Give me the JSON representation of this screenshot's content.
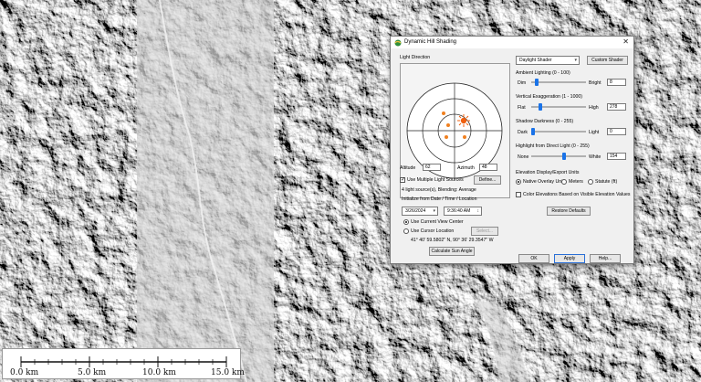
{
  "map": {
    "scalebar": {
      "labels": [
        "0.0 km",
        "5.0 km",
        "10.0 km",
        "15.0 km"
      ]
    }
  },
  "dialog": {
    "title": "Dynamic Hill Shading",
    "light_direction": {
      "group_label": "Light Direction",
      "altitude_label": "Altitude",
      "altitude_value": "62",
      "azimuth_label": "Azimuth",
      "azimuth_value": "48"
    },
    "multiple_light": {
      "label": "Use Multiple Light Sources",
      "checked": true,
      "define_label": "Define..."
    },
    "light_info": "4 light source(s), Blending: Average",
    "initialize_label": "Initialize from Date / Time / Location",
    "date_value": "3/26/2024",
    "time_value": "9:36:40 AM",
    "location": {
      "current_view": "Use Current View Center",
      "cursor": "Use Cursor Location",
      "select_label": "Select...",
      "coords": "41° 40' 59.5802\" N, 90° 36' 29.3547\" W"
    },
    "calc_sun": "Calculate Sun Angle",
    "shader_select": "Daylight Shader",
    "custom_shader": "Custom Shader",
    "ambient": {
      "label": "Ambient Lighting (0 - 100)",
      "min": "Dim",
      "max": "Bright",
      "value": "8",
      "level": 0.08
    },
    "vertical": {
      "label": "Vertical Exaggeration (1 - 1000)",
      "min": "Flat",
      "max": "High",
      "value": "278",
      "level": 0.15
    },
    "shadow": {
      "label": "Shadow Darkness (0 - 255)",
      "min": "Dark",
      "max": "Light",
      "value": "0",
      "level": 0.0
    },
    "highlight": {
      "label": "Highlight from Direct Light (0 - 255)",
      "min": "None",
      "max": "White",
      "value": "154",
      "level": 0.6
    },
    "units": {
      "label": "Elevation Display/Export Units",
      "options": [
        "Native Overlay Units",
        "Meters",
        "Statute (ft)"
      ],
      "selected": 0
    },
    "color_elev": "Color Elevations Based on Visible Elevation Values",
    "restore": "Restore Defaults",
    "ok": "OK",
    "apply": "Apply",
    "help": "Help..."
  }
}
